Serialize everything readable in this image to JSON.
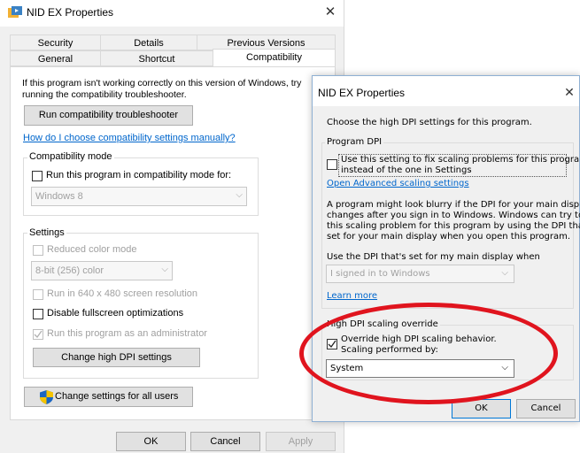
{
  "main_window": {
    "title": "NID EX Properties",
    "tabs_row1": [
      "Security",
      "Details",
      "Previous Versions"
    ],
    "tabs_row2": [
      "General",
      "Shortcut",
      "Compatibility"
    ],
    "intro_line1": "If this program isn't working correctly on this version of Windows, try",
    "intro_line2": "running the compatibility troubleshooter.",
    "troubleshooter_button": "Run compatibility troubleshooter",
    "manual_link": "How do I choose compatibility settings manually?",
    "compat_mode": {
      "label": "Compatibility mode",
      "checkbox_label": "Run this program in compatibility mode for:",
      "checked": false,
      "os_selected": "Windows 8"
    },
    "settings": {
      "label": "Settings",
      "reduced_color": "Reduced color mode",
      "color_selected": "8-bit (256) color",
      "resolution": "Run in 640 x 480 screen resolution",
      "fullscreen": "Disable fullscreen optimizations",
      "admin": "Run this program as an administrator",
      "dpi_button": "Change high DPI settings"
    },
    "all_users_button": "Change settings for all users",
    "ok": "OK",
    "cancel": "Cancel",
    "apply": "Apply"
  },
  "dpi_dialog": {
    "title": "NID EX Properties",
    "heading": "Choose the high DPI settings for this program.",
    "program_dpi": {
      "label": "Program DPI",
      "checkbox_line1": "Use this setting to fix scaling problems for this program",
      "checkbox_line2": "instead of the one in Settings",
      "checked": false,
      "advanced_link": "Open Advanced scaling settings",
      "desc_lines": [
        "A program might look blurry if the DPI for your main display",
        "changes after you sign in to Windows. Windows can try to fix",
        "this scaling problem for this program by using the DPI that's",
        "set for your main display when you open this program."
      ],
      "use_dpi_label": "Use the DPI that's set for my main display when",
      "dpi_when_selected": "I signed in to Windows",
      "learn_more": "Learn more"
    },
    "override": {
      "label": "High DPI scaling override",
      "checkbox_line1": "Override high DPI scaling behavior.",
      "checkbox_line2": "Scaling performed by:",
      "checked": true,
      "scaling_selected": "System"
    },
    "ok": "OK",
    "cancel": "Cancel"
  },
  "colors": {
    "link": "#0066cc",
    "highlight_ellipse": "#e0141e",
    "dialog_border": "#8fb0d3"
  }
}
